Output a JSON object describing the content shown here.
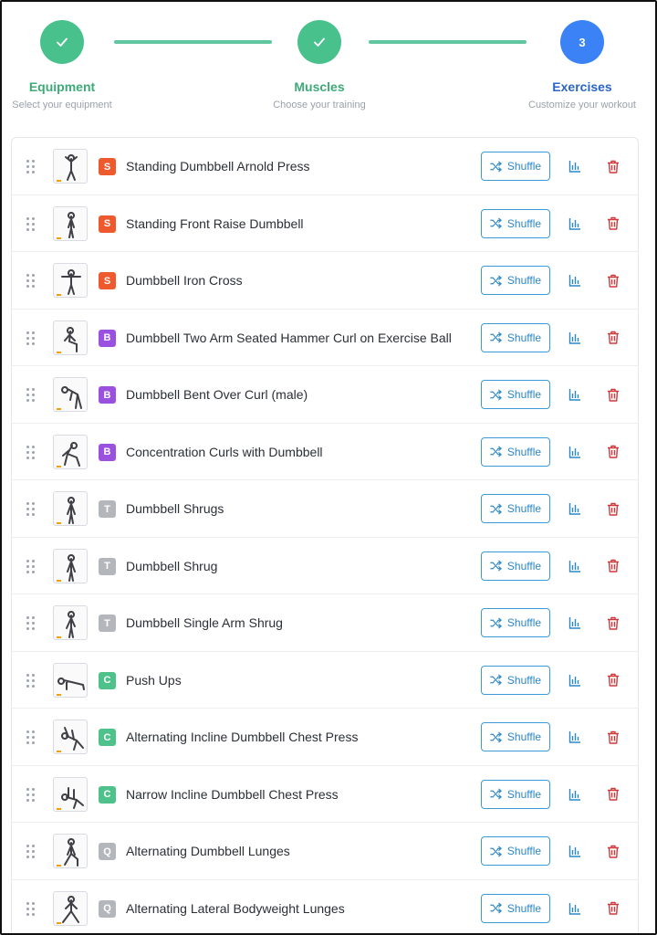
{
  "stepper": {
    "steps": [
      {
        "title": "Equipment",
        "subtitle": "Select your equipment",
        "state": "done",
        "icon": "check-icon"
      },
      {
        "title": "Muscles",
        "subtitle": "Choose your training",
        "state": "done",
        "icon": "check-icon"
      },
      {
        "title": "Exercises",
        "subtitle": "Customize your workout",
        "state": "current",
        "number": "3"
      }
    ]
  },
  "colors": {
    "done": "#48c18c",
    "current": "#3b82f6",
    "badge_S": "#ee5a2d",
    "badge_B": "#9b51e0",
    "badge_T": "#b3b6bb",
    "badge_C": "#4fc28b",
    "badge_Q": "#b3b6bb",
    "shuffle": "#2b87c6",
    "stats": "#2b87c6",
    "trash": "#d0393b"
  },
  "actions": {
    "shuffle_label": "Shuffle",
    "shuffle_icon": "shuffle-icon",
    "stats_icon": "bar-chart-icon",
    "delete_icon": "trash-icon"
  },
  "exercises": [
    {
      "badge": "S",
      "name": "Standing Dumbbell Arnold Press"
    },
    {
      "badge": "S",
      "name": "Standing Front Raise Dumbbell"
    },
    {
      "badge": "S",
      "name": "Dumbbell Iron Cross"
    },
    {
      "badge": "B",
      "name": "Dumbbell Two Arm Seated Hammer Curl on Exercise Ball"
    },
    {
      "badge": "B",
      "name": "Dumbbell Bent Over Curl (male)"
    },
    {
      "badge": "B",
      "name": "Concentration Curls with Dumbbell"
    },
    {
      "badge": "T",
      "name": "Dumbbell Shrugs"
    },
    {
      "badge": "T",
      "name": "Dumbbell Shrug"
    },
    {
      "badge": "T",
      "name": "Dumbbell Single Arm Shrug"
    },
    {
      "badge": "C",
      "name": "Push Ups"
    },
    {
      "badge": "C",
      "name": "Alternating Incline Dumbbell Chest Press"
    },
    {
      "badge": "C",
      "name": "Narrow Incline Dumbbell Chest Press"
    },
    {
      "badge": "Q",
      "name": "Alternating Dumbbell Lunges"
    },
    {
      "badge": "Q",
      "name": "Alternating Lateral Bodyweight Lunges"
    }
  ]
}
